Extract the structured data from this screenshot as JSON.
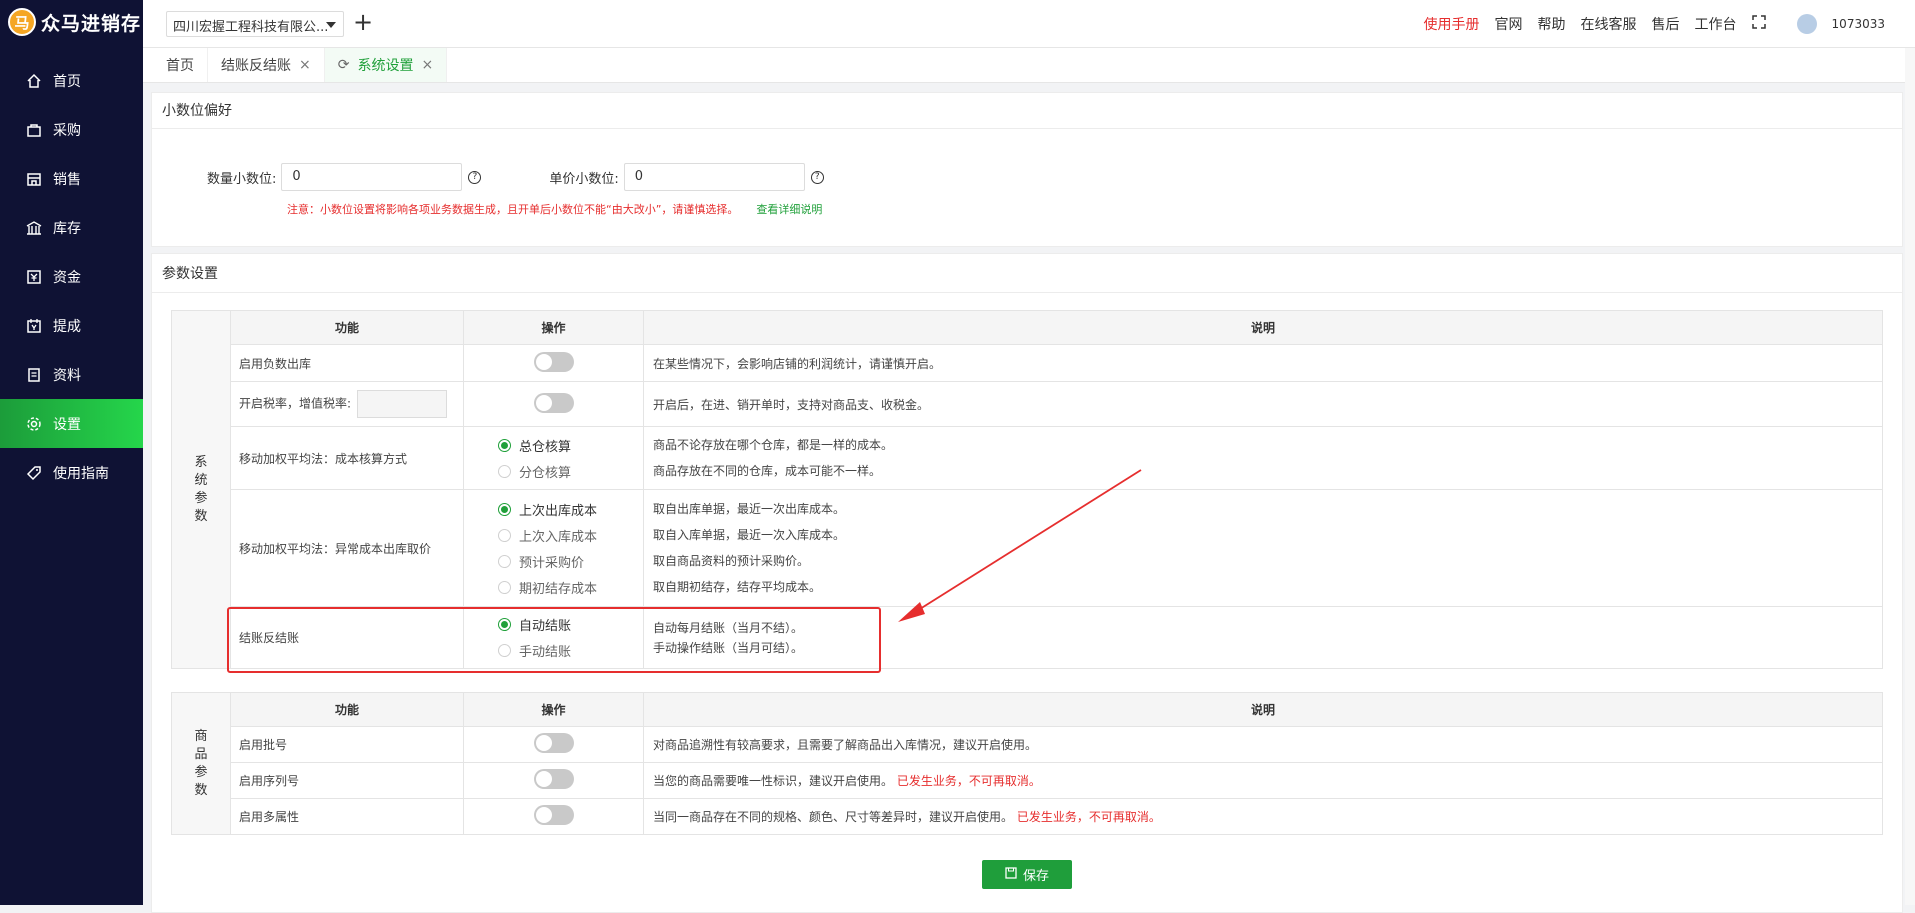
{
  "app": {
    "logo_text": "众马进销存",
    "logo_mark": "马"
  },
  "sidebar": {
    "items": [
      {
        "label": "首页",
        "icon": "home-icon"
      },
      {
        "label": "采购",
        "icon": "bag-icon"
      },
      {
        "label": "销售",
        "icon": "store-icon"
      },
      {
        "label": "库存",
        "icon": "warehouse-icon"
      },
      {
        "label": "资金",
        "icon": "money-icon"
      },
      {
        "label": "提成",
        "icon": "commission-icon"
      },
      {
        "label": "资料",
        "icon": "document-icon"
      },
      {
        "label": "设置",
        "icon": "gear-icon"
      },
      {
        "label": "使用指南",
        "icon": "tag-icon"
      }
    ],
    "active_index": 7
  },
  "header": {
    "company": "四川宏握工程科技有限公...",
    "links": [
      "使用手册",
      "官网",
      "帮助",
      "在线客服",
      "售后",
      "工作台"
    ],
    "user": "1073033"
  },
  "tabs": [
    {
      "label": "首页",
      "closable": false
    },
    {
      "label": "结账反结账",
      "closable": true
    },
    {
      "label": "系统设置",
      "closable": true,
      "active": true
    }
  ],
  "decimal": {
    "title": "小数位偏好",
    "qty_label": "数量小数位:",
    "qty_value": "0",
    "price_label": "单价小数位:",
    "price_value": "0",
    "note": "注意：小数位设置将影响各项业务数据生成，且开单后小数位不能“由大改小”，请谨慎选择。",
    "note_link": "查看详细说明"
  },
  "params": {
    "title": "参数设置",
    "col_func": "功能",
    "col_op": "操作",
    "col_desc": "说明",
    "system_label": [
      "系",
      "统",
      "参",
      "数"
    ],
    "goods_label": [
      "商",
      "品",
      "参",
      "数"
    ],
    "row_negative": {
      "func": "启用负数出库",
      "desc": "在某些情况下，会影响店铺的利润统计，请谨慎开启。"
    },
    "row_tax": {
      "func": "开启税率，增值税率:",
      "desc": "开启后，在进、销开单时，支持对商品支、收税金。"
    },
    "row_cost_method": {
      "func": "移动加权平均法：成本核算方式",
      "options": [
        "总仓核算",
        "分仓核算"
      ],
      "desc": [
        "商品不论存放在哪个仓库，都是一样的成本。",
        "商品存放在不同的仓库，成本可能不一样。"
      ]
    },
    "row_abnormal": {
      "func": "移动加权平均法：异常成本出库取价",
      "options": [
        "上次出库成本",
        "上次入库成本",
        "预计采购价",
        "期初结存成本"
      ],
      "desc": [
        "取自出库单据，最近一次出库成本。",
        "取自入库单据，最近一次入库成本。",
        "取自商品资料的预计采购价。",
        "取自期初结存，结存平均成本。"
      ]
    },
    "row_closing": {
      "func": "结账反结账",
      "options": [
        "自动结账",
        "手动结账"
      ],
      "desc": [
        "自动每月结账（当月不结）。",
        "手动操作结账（当月可结）。"
      ]
    },
    "row_batch": {
      "func": "启用批号",
      "desc": "对商品追溯性有较高要求，且需要了解商品出入库情况，建议开启使用。"
    },
    "row_serial": {
      "func": "启用序列号",
      "desc": "当您的商品需要唯一性标识，建议开启使用。",
      "warn": "已发生业务，不可再取消。"
    },
    "row_multi": {
      "func": "启用多属性",
      "desc": "当同一商品存在不同的规格、颜色、尺寸等差异时，建议开启使用。",
      "warn": "已发生业务，不可再取消。"
    }
  },
  "save_label": "保存",
  "colors": {
    "sidebar": "#0f1234",
    "accent": "#20a03a",
    "warning": "#e62e2e"
  }
}
